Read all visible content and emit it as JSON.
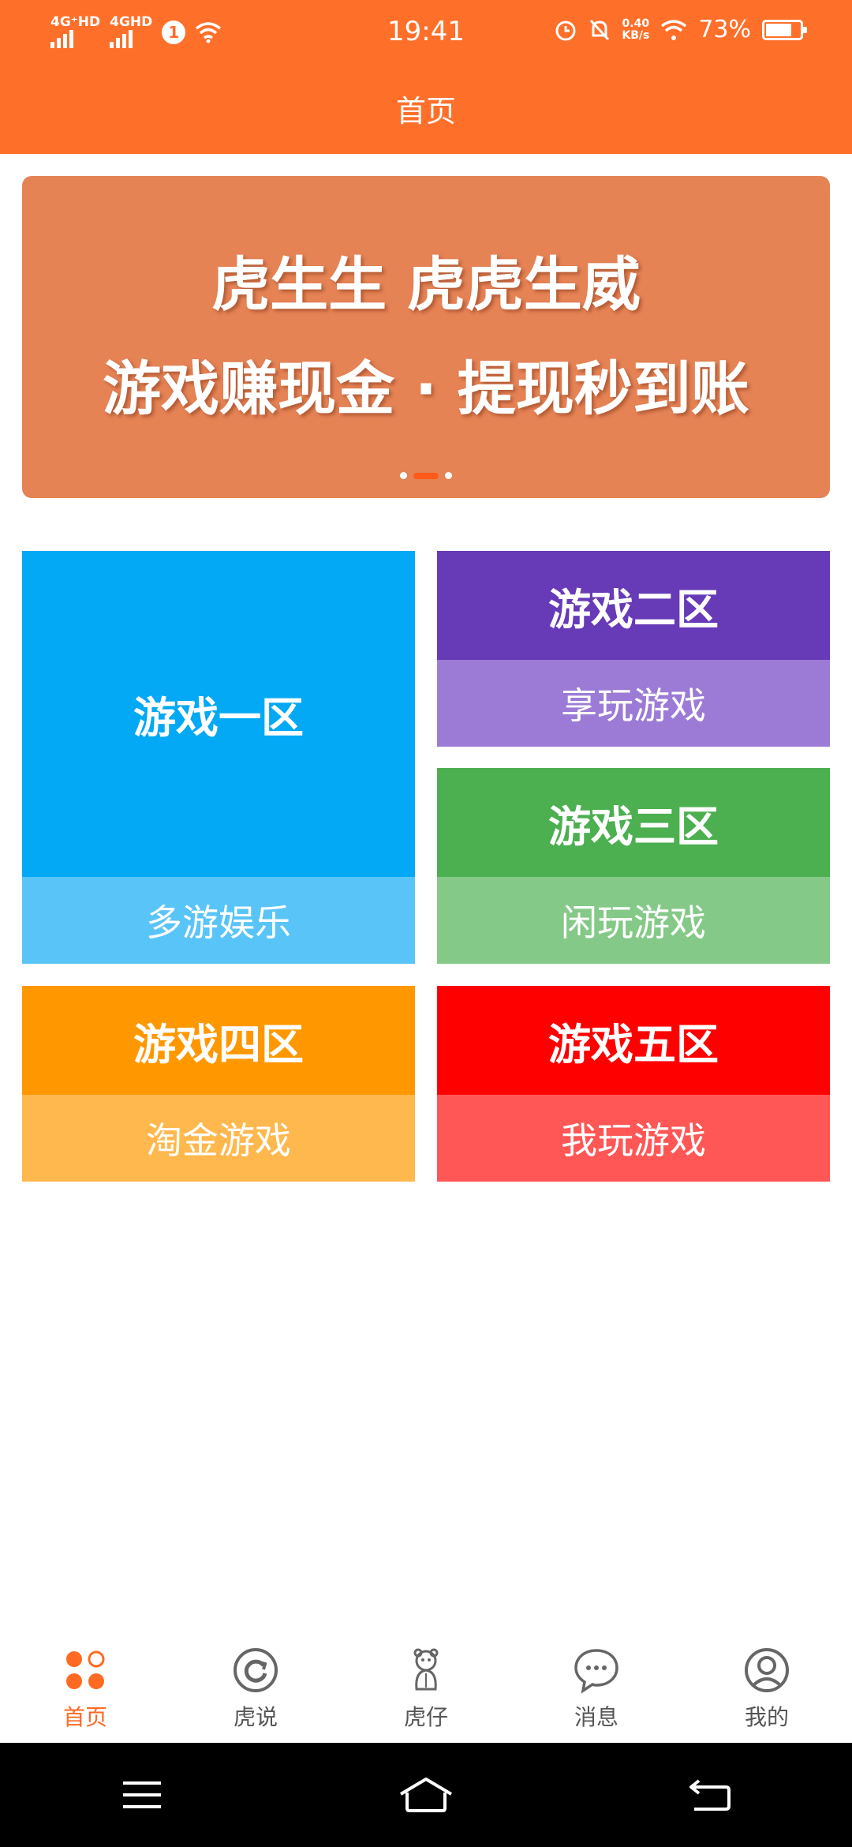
{
  "status_bar": {
    "sim1": "4G⁺HD",
    "sim2": "4GHD",
    "sim_badge": "1",
    "time": "19:41",
    "net_speed_value": "0.40",
    "net_speed_unit": "KB/s",
    "battery": "73%"
  },
  "header": {
    "title": "首页"
  },
  "banner": {
    "line1": "虎生生 虎虎生威",
    "line2": "游戏赚现金 · 提现秒到账",
    "slide_count": 3,
    "active_slide": 1
  },
  "zones": [
    {
      "title": "游戏一区",
      "subtitle": "多游娱乐",
      "color": "#03a9f4"
    },
    {
      "title": "游戏二区",
      "subtitle": "享玩游戏",
      "color": "#673ab7"
    },
    {
      "title": "游戏三区",
      "subtitle": "闲玩游戏",
      "color": "#4caf50"
    },
    {
      "title": "游戏四区",
      "subtitle": "淘金游戏",
      "color": "#ff9800"
    },
    {
      "title": "游戏五区",
      "subtitle": "我玩游戏",
      "color": "#ff0000"
    }
  ],
  "tabbar": {
    "accent": "#ff6a22",
    "items": [
      {
        "label": "首页",
        "icon": "home-dots-icon",
        "active": true
      },
      {
        "label": "虎说",
        "icon": "refresh-circle-icon",
        "active": false
      },
      {
        "label": "虎仔",
        "icon": "tiger-cub-icon",
        "active": false
      },
      {
        "label": "消息",
        "icon": "chat-bubble-icon",
        "active": false
      },
      {
        "label": "我的",
        "icon": "profile-icon",
        "active": false
      }
    ]
  },
  "navbar": {
    "items": [
      {
        "icon": "menu-icon"
      },
      {
        "icon": "home-icon"
      },
      {
        "icon": "back-icon"
      }
    ]
  }
}
